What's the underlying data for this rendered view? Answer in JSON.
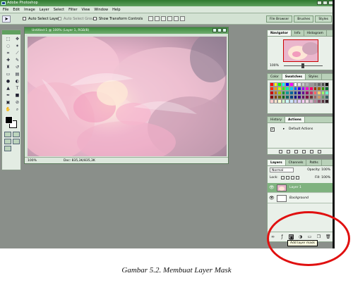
{
  "window": {
    "title": "Adobe Photoshop"
  },
  "menu": [
    "File",
    "Edit",
    "Image",
    "Layer",
    "Select",
    "Filter",
    "View",
    "Window",
    "Help"
  ],
  "options": {
    "auto_select_layer": "Auto Select Layer",
    "auto_select_groups": "Auto Select Groups",
    "show_transform_controls": "Show Transform Controls"
  },
  "palette_well": [
    "File Browser",
    "Brushes",
    "Styles"
  ],
  "document": {
    "title": "Untitled-1 @ 100% (Layer 1, RGB/8)",
    "zoom": "100%",
    "doc_info": "Doc: 835,3K/835,3K"
  },
  "navigator": {
    "tabs": [
      "Navigator",
      "Info",
      "Histogram"
    ],
    "zoom": "100%"
  },
  "swatches": {
    "tabs": [
      "Color",
      "Swatches",
      "Styles"
    ],
    "colors": [
      "#ff0000",
      "#ffff00",
      "#00ff00",
      "#00ffff",
      "#0000ff",
      "#ff00ff",
      "#ffffff",
      "#e6e6e6",
      "#cccccc",
      "#b3b3b3",
      "#999999",
      "#808080",
      "#666666",
      "#4d4d4d",
      "#000000",
      "#ff3300",
      "#ff9900",
      "#ccff00",
      "#33ff00",
      "#00ff99",
      "#00ccff",
      "#0066ff",
      "#3300ff",
      "#9900ff",
      "#ff00cc",
      "#ff0066",
      "#993300",
      "#996600",
      "#339900",
      "#006633",
      "#cc0000",
      "#cc6600",
      "#99cc00",
      "#009933",
      "#009999",
      "#006699",
      "#003399",
      "#330099",
      "#660099",
      "#990066",
      "#cc3366",
      "#ff6666",
      "#ffcc66",
      "#99ff66",
      "#66ffcc",
      "#800000",
      "#804000",
      "#666600",
      "#006600",
      "#006666",
      "#004080",
      "#000080",
      "#400080",
      "#660066",
      "#800040",
      "#663333",
      "#996666",
      "#cc9966",
      "#669966",
      "#336666",
      "#ffcccc",
      "#ffe5cc",
      "#ffffcc",
      "#ccffcc",
      "#ccffff",
      "#cce5ff",
      "#ccccff",
      "#e5ccff",
      "#ffccff",
      "#f2d9e6",
      "#d9b3cc",
      "#b38099",
      "#8c4d66",
      "#593340",
      "#2b1a20"
    ]
  },
  "history": {
    "tabs": [
      "History",
      "Actions"
    ],
    "default_actions": "Default Actions"
  },
  "layers": {
    "tabs": [
      "Layers",
      "Channels",
      "Paths"
    ],
    "blend_mode": "Normal",
    "opacity_label": "Opacity:",
    "opacity": "100%",
    "lock_label": "Lock:",
    "fill_label": "Fill:",
    "fill": "100%",
    "items": [
      {
        "name": "Layer 1",
        "selected": true
      },
      {
        "name": "Background",
        "selected": false
      }
    ],
    "tooltip": "Add layer mask"
  },
  "caption": "Gambar 5.2. Membuat Layer Mask"
}
